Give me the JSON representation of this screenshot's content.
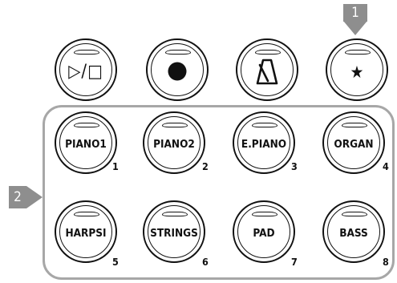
{
  "top_row": {
    "play_stop_glyph": "▷/□",
    "record_glyph": "●",
    "metronome_glyph": "metronome",
    "favorite_glyph": "★"
  },
  "markers": {
    "m1": "1",
    "m2": "2"
  },
  "tones": [
    {
      "label": "PIANO1",
      "number": "1"
    },
    {
      "label": "PIANO2",
      "number": "2"
    },
    {
      "label": "E.PIANO",
      "number": "3"
    },
    {
      "label": "ORGAN",
      "number": "4"
    },
    {
      "label": "HARPSI",
      "number": "5"
    },
    {
      "label": "STRINGS",
      "number": "6"
    },
    {
      "label": "PAD",
      "number": "7"
    },
    {
      "label": "BASS",
      "number": "8"
    }
  ],
  "colors": {
    "outline": "#111111",
    "frame": "#a7a7a7",
    "marker": "#8e8e8e"
  }
}
